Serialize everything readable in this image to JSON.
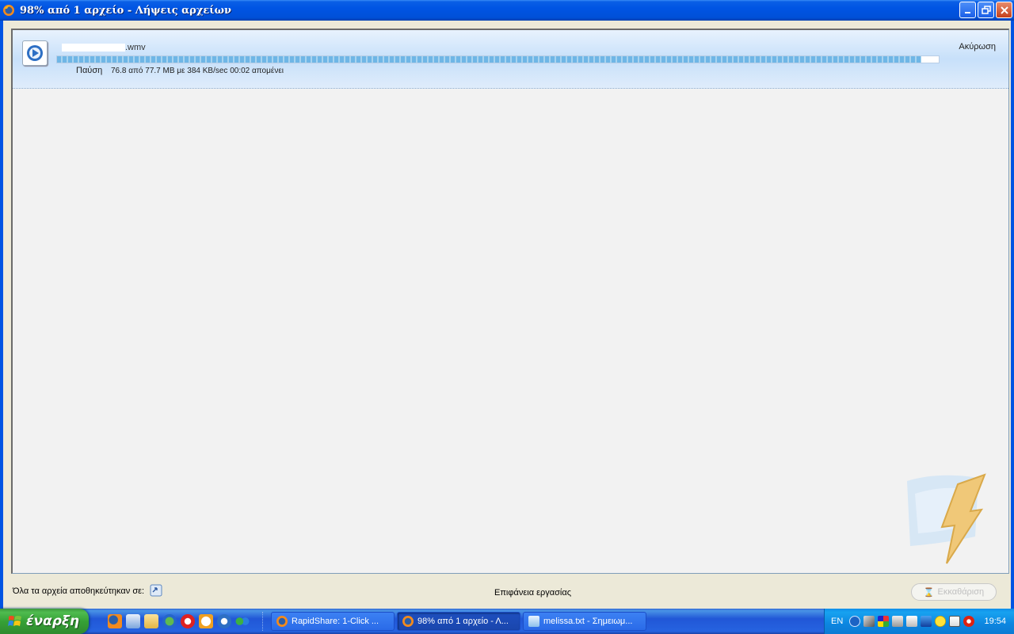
{
  "window": {
    "title": "98% από 1 αρχείο - Λήψεις αρχείων"
  },
  "download": {
    "file_name_suffix": ".wmv",
    "progress_percent": 98,
    "pause_label": "Παύση",
    "status": "76.8 από 77.7 MB με 384 KB/sec 00:02 απομένει",
    "cancel_label": "Ακύρωση"
  },
  "footer": {
    "saved_label": "Όλα τα αρχεία αποθηκεύτηκαν σε:",
    "folder_name": "Επιφάνεια εργασίας",
    "clear_label": "Εκκαθάριση"
  },
  "taskbar": {
    "start_label": "έναρξη",
    "tasks": [
      {
        "label": "RapidShare: 1-Click ...",
        "icon": "firefox-icon"
      },
      {
        "label": "98% από 1 αρχείο - Λ...",
        "icon": "firefox-icon"
      },
      {
        "label": "melissa.txt - Σημειωμ...",
        "icon": "notepad-icon"
      }
    ],
    "language": "EN",
    "clock": "19:54"
  }
}
